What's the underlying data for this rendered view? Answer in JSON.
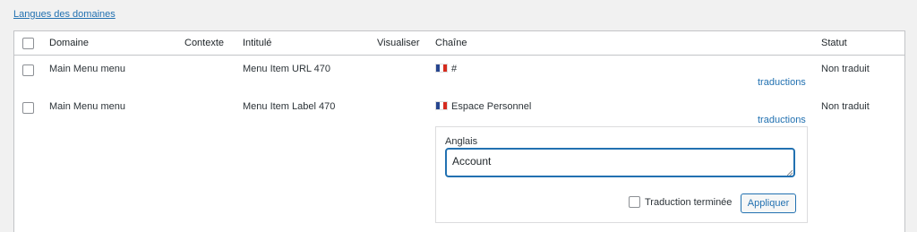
{
  "top_link": "Langues des domaines",
  "columns": {
    "domaine": "Domaine",
    "contexte": "Contexte",
    "intitule": "Intitulé",
    "visualiser": "Visualiser",
    "chaine": "Chaîne",
    "statut": "Statut"
  },
  "rows": [
    {
      "domaine": "Main Menu menu",
      "intitule": "Menu Item URL 470",
      "chaine": "#",
      "translations_link": "traductions",
      "statut": "Non traduit"
    },
    {
      "domaine": "Main Menu menu",
      "intitule": "Menu Item Label 470",
      "chaine": "Espace Personnel",
      "translations_link": "traductions",
      "statut": "Non traduit"
    }
  ],
  "editor": {
    "language_label": "Anglais",
    "value": "Account",
    "done_label": "Traduction terminée",
    "apply_label": "Appliquer"
  },
  "colors": {
    "link": "#2271b1",
    "border": "#c3c4c7",
    "background": "#f1f1f1"
  }
}
